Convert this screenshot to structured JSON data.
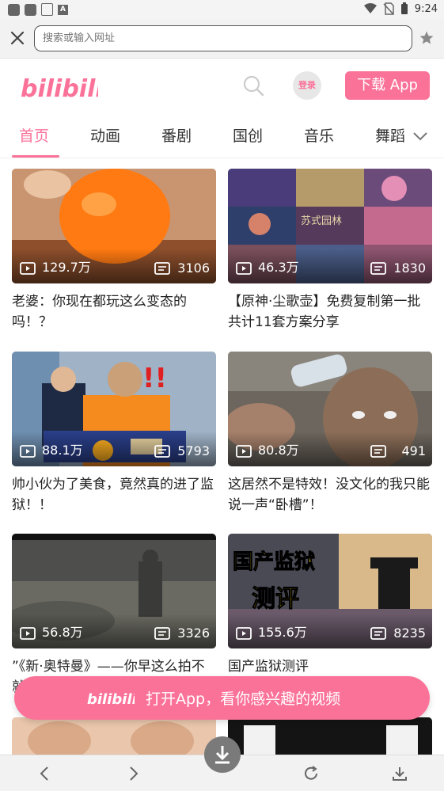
{
  "status_bar": {
    "time": "9:24"
  },
  "browser": {
    "url_placeholder": "搜索或输入网址"
  },
  "header": {
    "logo_text": "bilibili",
    "login_label": "登录",
    "download_label": "下载 App"
  },
  "tabs": [
    "首页",
    "动画",
    "番剧",
    "国创",
    "音乐",
    "舞蹈"
  ],
  "videos": [
    {
      "views": "129.7万",
      "danmaku": "3106",
      "title": "老婆：你现在都玩这么变态的吗！？"
    },
    {
      "views": "46.3万",
      "danmaku": "1830",
      "title": "【原神·尘歌壶】免费复制第一批共计11套方案分享"
    },
    {
      "views": "88.1万",
      "danmaku": "5793",
      "title": "帅小伙为了美食，竟然真的进了监狱！！"
    },
    {
      "views": "80.8万",
      "danmaku": "491",
      "title": "这居然不是特效！没文化的我只能说一声“卧槽”！"
    },
    {
      "views": "56.8万",
      "danmaku": "3326",
      "title": "”《新·奥特曼》——你早这么拍不就"
    },
    {
      "views": "155.6万",
      "danmaku": "8235",
      "title": "国产监狱测评"
    }
  ],
  "thumb_text": {
    "card6_line1": "国产监狱",
    "card6_line2": "测评",
    "card2_caption": "苏式园林"
  },
  "open_app": {
    "label": "打开App，看你感兴趣的视频"
  },
  "colors": {
    "brand_pink": "#fb7299"
  }
}
